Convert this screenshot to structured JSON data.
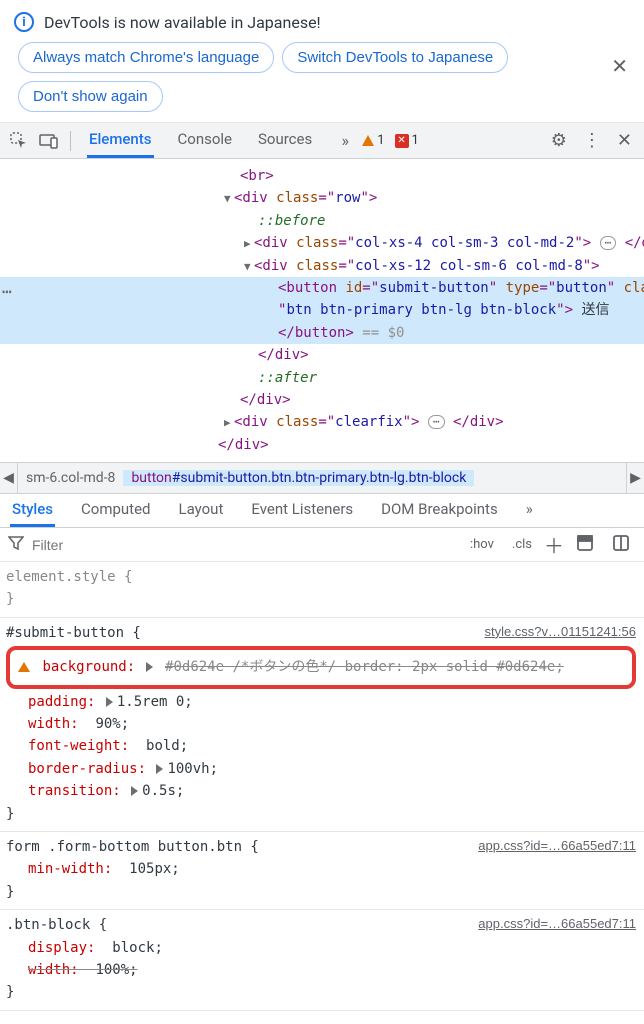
{
  "notif": {
    "message": "DevTools is now available in Japanese!",
    "btn_match": "Always match Chrome's language",
    "btn_switch": "Switch DevTools to Japanese",
    "btn_dont": "Don't show again"
  },
  "toolbar": {
    "tabs": {
      "elements": "Elements",
      "console": "Console",
      "sources": "Sources"
    },
    "more_chevrons": "»",
    "warn_count": "1",
    "err_count": "1"
  },
  "dom": {
    "l_br": "<br>",
    "l_rowdiv_open": "<div class=\"row\">",
    "l_before": "::before",
    "l_col1_open": "<div class=\"col-xs-4 col-sm-3 col-md-2\">",
    "l_col1_ell": "…",
    "l_col1_close": "</div>",
    "l_col2_open": "<div class=\"col-xs-12 col-sm-6 col-md-8\">",
    "l_btn_open1": "<button id=\"submit-button\" type=\"button\" class=",
    "l_btn_open2": "\"btn btn-primary btn-lg btn-block\">",
    "l_btn_text": "送信",
    "l_btn_close": "</button>",
    "l_eq0": "== $0",
    "l_col2_close": "</div>",
    "l_after": "::after",
    "l_rowdiv_close": "</div>",
    "l_clearfix_open": "<div class=\"clearfix\">",
    "l_clearfix_ell": "…",
    "l_clearfix_close": "</div>",
    "l_outer_close": "</div>"
  },
  "crumb": {
    "left": "sm-6.col-md-8",
    "sel": "button#submit-button.btn.btn-primary.btn-lg.btn-block",
    "sel_tag": "button",
    "sel_rest": "#submit-button.btn.btn-primary.btn-lg.btn-block"
  },
  "subtabs": {
    "styles": "Styles",
    "computed": "Computed",
    "layout": "Layout",
    "listeners": "Event Listeners",
    "dom_bp": "DOM Breakpoints",
    "more": "»"
  },
  "filter": {
    "placeholder": "Filter",
    "hov": ":hov",
    "cls": ".cls"
  },
  "rules": {
    "elstyle_sel": "element.style {",
    "close": "}",
    "r_submit": {
      "selector": "#submit-button {",
      "source": "style.css?v…01151241:56",
      "bg_label": "background:",
      "bg_val": "#0d624e /*ボタンの色*/ border: 2px solid #0d624e;",
      "padding_label": "padding:",
      "padding_val": "1.5rem 0;",
      "width_label": "width:",
      "width_val": "90%;",
      "fw_label": "font-weight:",
      "fw_val": "bold;",
      "br_label": "border-radius:",
      "br_val": "100vh;",
      "tr_label": "transition:",
      "tr_val": "0.5s;"
    },
    "r_form": {
      "selector": "form .form-bottom button.btn {",
      "source": "app.css?id=…66a55ed7:11",
      "mw_label": "min-width:",
      "mw_val": "105px;"
    },
    "r_block": {
      "selector": ".btn-block {",
      "source": "app.css?id=…66a55ed7:11",
      "disp_label": "display:",
      "disp_val": "block;",
      "width_label": "width:",
      "width_val": "100%;"
    }
  }
}
